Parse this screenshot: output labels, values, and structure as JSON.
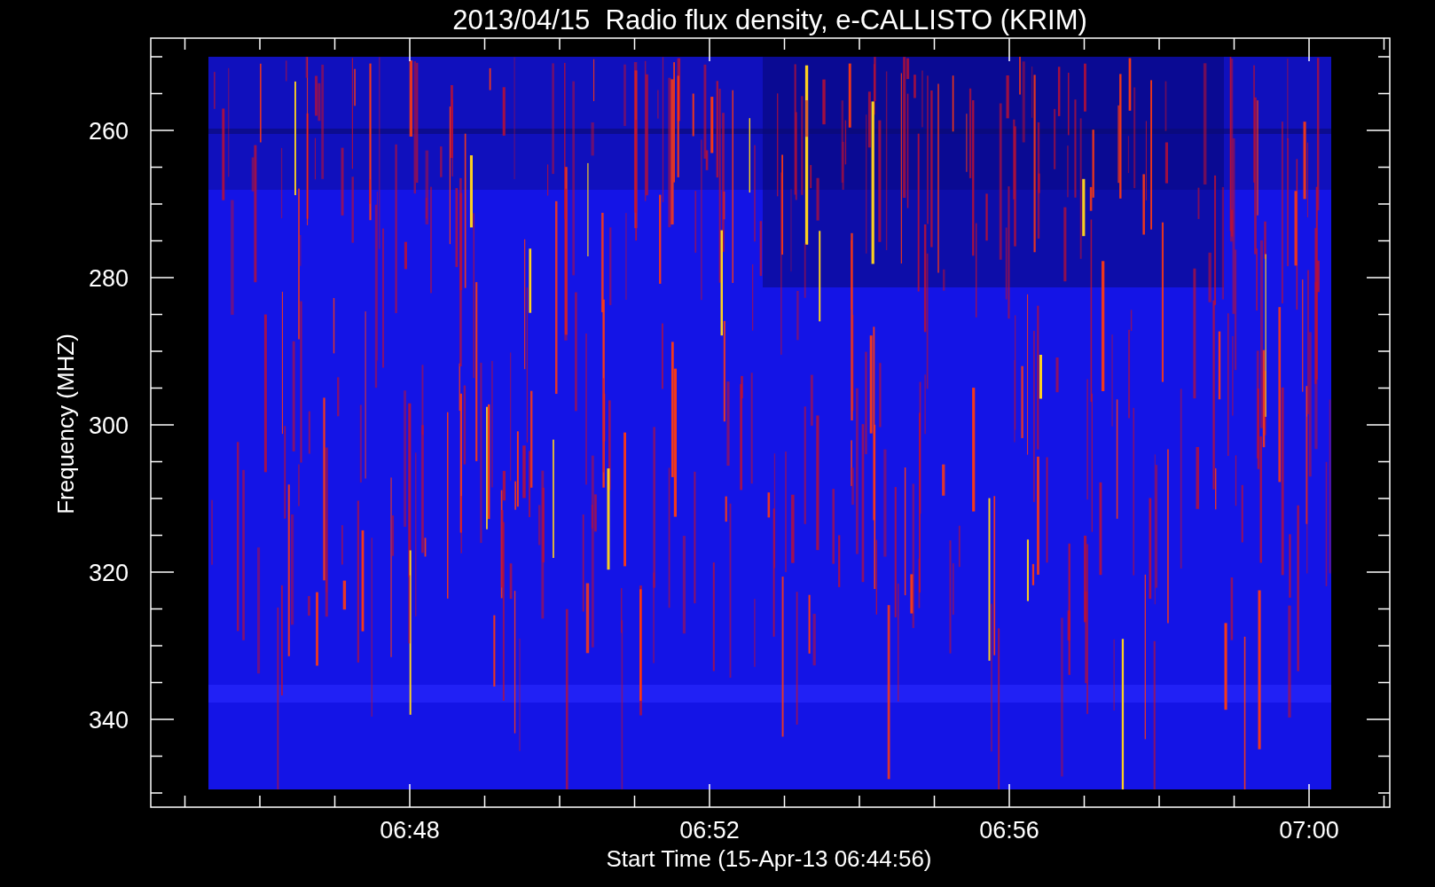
{
  "chart": {
    "title": "2013/04/15  Radio flux density, e-CALLISTO (KRIM)",
    "ylabel": "Frequency (MHZ)",
    "xlabel": "Start Time (15-Apr-13 06:44:56)",
    "yticks": [
      "260",
      "280",
      "300",
      "320",
      "340"
    ],
    "xticks": [
      "06:48",
      "06:52",
      "06:56",
      "07:00"
    ]
  }
}
